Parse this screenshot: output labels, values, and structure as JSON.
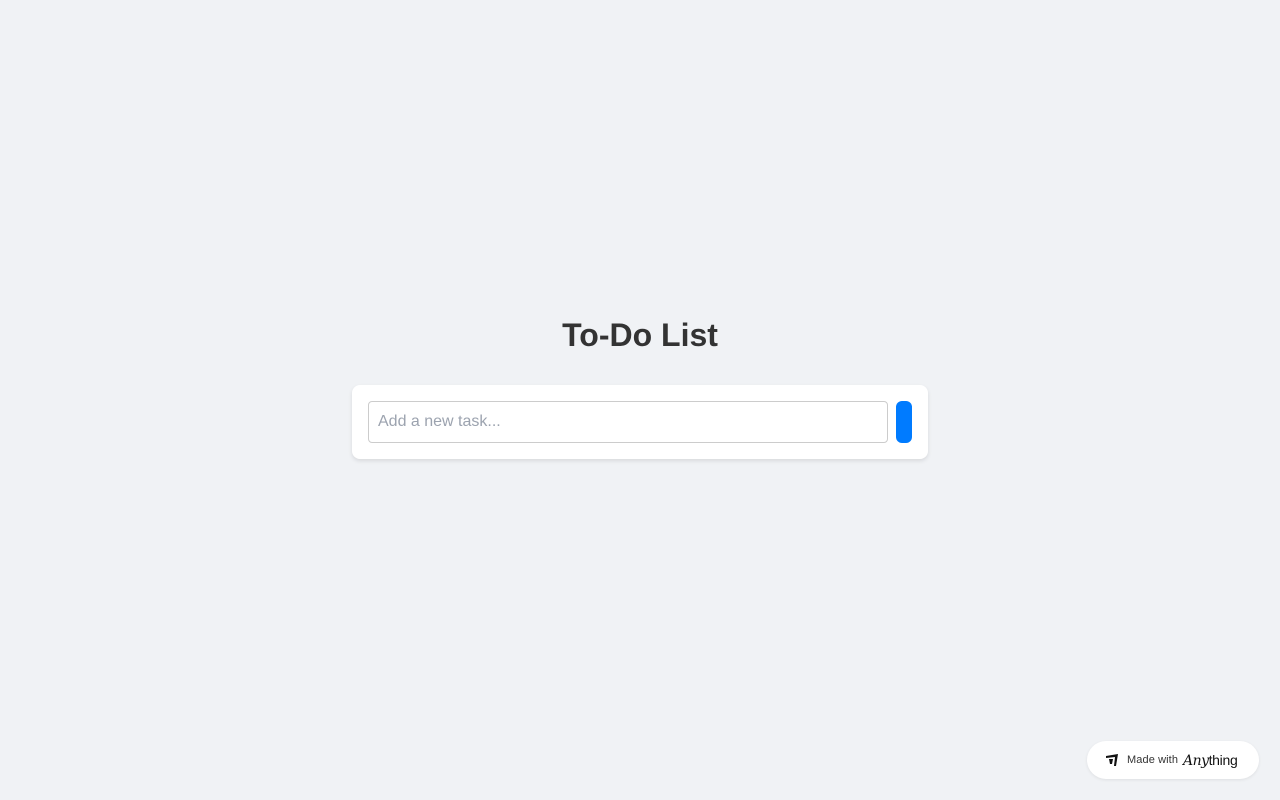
{
  "page": {
    "title": "To-Do List"
  },
  "todo": {
    "input_value": "",
    "input_placeholder": "Add a new task...",
    "add_button_label": ""
  },
  "badge": {
    "made_with": "Made with",
    "brand_part1": "Any",
    "brand_part2": "thing",
    "icon": "anything-logo-icon"
  },
  "colors": {
    "background": "#f0f2f5",
    "accent": "#007bff",
    "title": "#333333"
  }
}
